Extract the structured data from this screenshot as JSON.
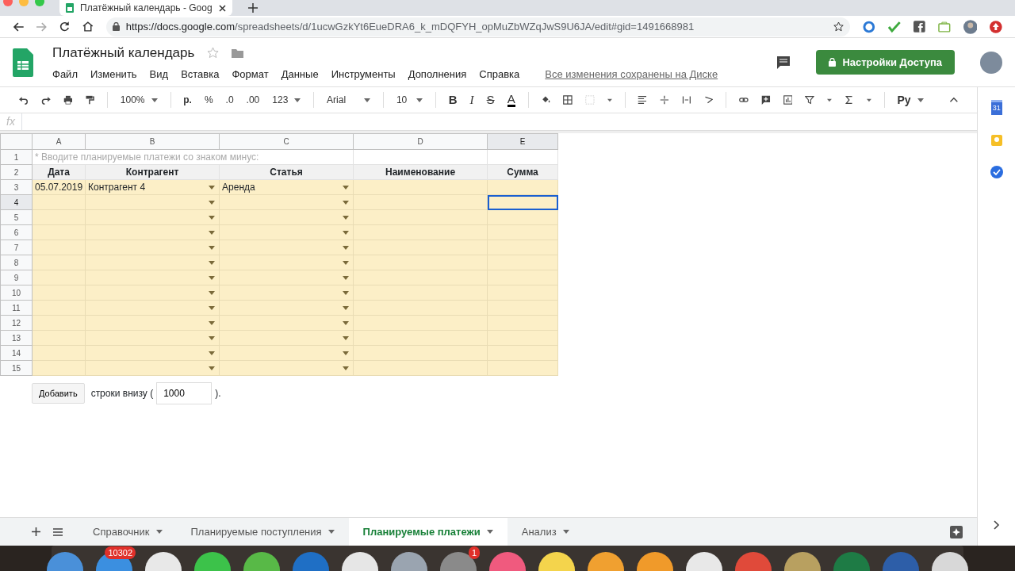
{
  "browser": {
    "tab_title": "Платёжный календарь - Goog",
    "url_host": "https://docs.google.com",
    "url_path": "/spreadsheets/d/1ucwGzkYt6EueDRA6_k_mDQFYH_opMuZbWZqJwS9U6JA/edit#gid=1491668981"
  },
  "document": {
    "title": "Платёжный календарь",
    "menu": [
      "Файл",
      "Изменить",
      "Вид",
      "Вставка",
      "Формат",
      "Данные",
      "Инструменты",
      "Дополнения",
      "Справка"
    ],
    "save_status": "Все изменения сохранены на Диске",
    "share_button": "Настройки Доступа"
  },
  "toolbar": {
    "zoom": "100%",
    "currency": "р.",
    "percent": "%",
    "decrease_decimals": ".0",
    "increase_decimals": ".00",
    "more_formats": "123",
    "font": "Arial",
    "font_size": "10",
    "bold": "B",
    "italic": "I",
    "strikethrough": "S",
    "text_color": "A",
    "input_tools": "Pу"
  },
  "formula_bar": {
    "label": "fx"
  },
  "grid": {
    "columns": [
      {
        "label": "A",
        "selected": false
      },
      {
        "label": "B",
        "selected": false
      },
      {
        "label": "C",
        "selected": false
      },
      {
        "label": "D",
        "selected": false
      },
      {
        "label": "E",
        "selected": true
      }
    ],
    "rows": [
      {
        "number": "1",
        "kind": "note",
        "text": "* Вводите планируемые платежи со знаком минус:",
        "selected": false
      },
      {
        "number": "2",
        "kind": "header",
        "cells": [
          "Дата",
          "Контрагент",
          "Статья",
          "Наименование",
          "Сумма"
        ],
        "selected": false
      },
      {
        "number": "3",
        "kind": "data",
        "date": "05.07.2019",
        "counterparty": "Контрагент 4",
        "item": "Аренда",
        "selected": false
      },
      {
        "number": "4",
        "kind": "data",
        "selected": true
      },
      {
        "number": "5",
        "kind": "data",
        "selected": false
      },
      {
        "number": "6",
        "kind": "data",
        "selected": false
      },
      {
        "number": "7",
        "kind": "data",
        "selected": false
      },
      {
        "number": "8",
        "kind": "data",
        "selected": false
      },
      {
        "number": "9",
        "kind": "data",
        "selected": false
      },
      {
        "number": "10",
        "kind": "data",
        "selected": false
      },
      {
        "number": "11",
        "kind": "data",
        "selected": false
      },
      {
        "number": "12",
        "kind": "data",
        "selected": false
      },
      {
        "number": "13",
        "kind": "data",
        "selected": false
      },
      {
        "number": "14",
        "kind": "data",
        "selected": false
      },
      {
        "number": "15",
        "kind": "data",
        "selected": false
      }
    ]
  },
  "add_rows": {
    "button": "Добавить",
    "label": "строки внизу (",
    "value": "1000",
    "suffix": ")."
  },
  "sheet_tabs": [
    {
      "label": "Справочник",
      "selected": false
    },
    {
      "label": "Планируемые поступления",
      "selected": false
    },
    {
      "label": "Планируемые платежи",
      "selected": true
    },
    {
      "label": "Анализ",
      "selected": false
    }
  ],
  "side_panel": {
    "calendar_day": "31"
  },
  "dock": [
    {
      "color": "#4a90d9"
    },
    {
      "color": "#3b8fe0",
      "badge": "10302"
    },
    {
      "color": "#e8e8e8"
    },
    {
      "color": "#3cc24a"
    },
    {
      "color": "#58b947"
    },
    {
      "color": "#1f6fc5"
    },
    {
      "color": "#e6e6e6"
    },
    {
      "color": "#9aa4b0"
    },
    {
      "color": "#8a8a8a",
      "badge": "1"
    },
    {
      "color": "#f05a7e"
    },
    {
      "color": "#f4d44c"
    },
    {
      "color": "#f0a030"
    },
    {
      "color": "#f09a2a"
    },
    {
      "color": "#e8e8e8"
    },
    {
      "color": "#e04a3a"
    },
    {
      "color": "#b8a060"
    },
    {
      "color": "#1e7b45"
    },
    {
      "color": "#2d5ea8"
    },
    {
      "color": "#d8d8d8"
    }
  ]
}
